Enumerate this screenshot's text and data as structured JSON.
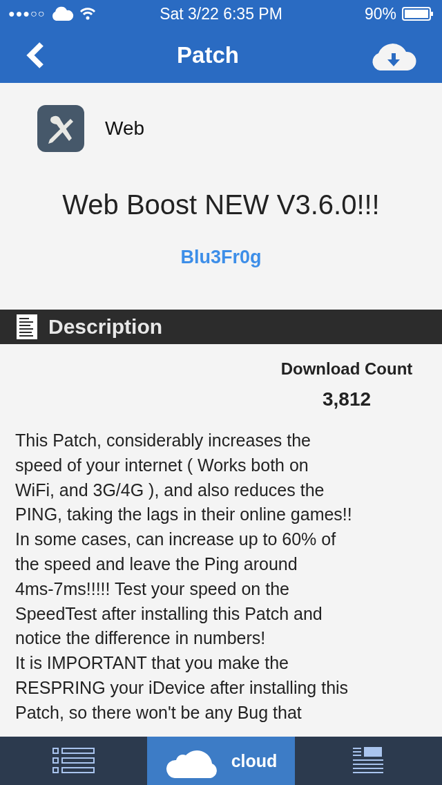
{
  "status_bar": {
    "carrier_dots": "●●●○○",
    "time": "Sat 3/22 6:35 PM",
    "battery": "90%"
  },
  "nav_bar": {
    "title": "Patch"
  },
  "app": {
    "category": "Web",
    "title": "Web Boost NEW V3.6.0!!!",
    "author": "Blu3Fr0g"
  },
  "section": {
    "title": "Description"
  },
  "download": {
    "label": "Download Count",
    "count": "3,812"
  },
  "description": {
    "lines": [
      "This Patch, considerably increases the",
      "speed of your internet ( Works both on",
      "WiFi, and 3G/4G ), and also reduces the",
      "PING, taking the lags in their online games!!",
      "In some cases, can increase up to 60% of",
      "the speed and leave the Ping around",
      "4ms-7ms!!!!! Test your speed on the",
      "SpeedTest after installing this Patch and",
      "notice the difference in numbers!",
      "It is IMPORTANT that you make the",
      "RESPRING your iDevice after installing this",
      "Patch, so there won't be any Bug that"
    ]
  },
  "tabs": [
    {
      "kind": "list",
      "selected": false
    },
    {
      "kind": "cloud",
      "label": "cloud",
      "selected": true
    },
    {
      "kind": "news",
      "selected": false
    }
  ]
}
